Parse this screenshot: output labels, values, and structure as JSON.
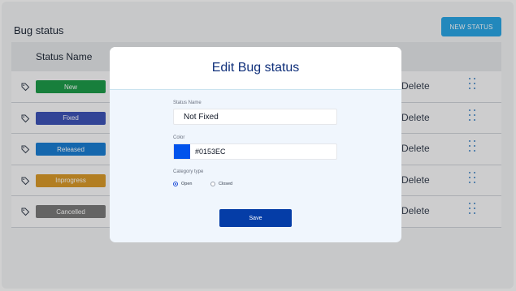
{
  "page": {
    "title": "Bug status",
    "new_status_label": "NEW STATUS"
  },
  "table": {
    "header": "Status Name",
    "rows": [
      {
        "name": "New",
        "color": "#1e9b4a",
        "action": "Delete"
      },
      {
        "name": "Fixed",
        "color": "#3e54b8",
        "action": "Delete"
      },
      {
        "name": "Released",
        "color": "#1a7ed4",
        "action": "Delete"
      },
      {
        "name": "Inprogress",
        "color": "#d99a2a",
        "action": "Delete"
      },
      {
        "name": "Cancelled",
        "color": "#7a7a7a",
        "action": "Delete"
      }
    ]
  },
  "modal": {
    "title": "Edit Bug status",
    "status_name_label": "Status Name",
    "status_name_value": "Not Fixed",
    "color_label": "Color",
    "color_value": "#0153EC",
    "category_label": "Category type",
    "options": [
      "Open",
      "Closed"
    ],
    "selected_option": "Open",
    "save_label": "Save"
  }
}
